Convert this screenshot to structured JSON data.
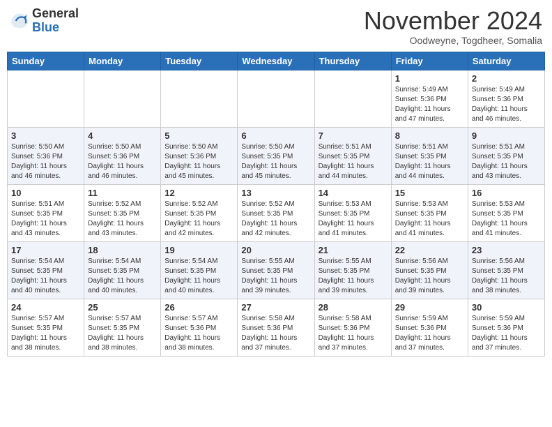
{
  "header": {
    "logo_general": "General",
    "logo_blue": "Blue",
    "month_title": "November 2024",
    "location": "Oodweyne, Togdheer, Somalia"
  },
  "calendar": {
    "days_of_week": [
      "Sunday",
      "Monday",
      "Tuesday",
      "Wednesday",
      "Thursday",
      "Friday",
      "Saturday"
    ],
    "weeks": [
      [
        {
          "day": "",
          "info": ""
        },
        {
          "day": "",
          "info": ""
        },
        {
          "day": "",
          "info": ""
        },
        {
          "day": "",
          "info": ""
        },
        {
          "day": "",
          "info": ""
        },
        {
          "day": "1",
          "info": "Sunrise: 5:49 AM\nSunset: 5:36 PM\nDaylight: 11 hours\nand 47 minutes."
        },
        {
          "day": "2",
          "info": "Sunrise: 5:49 AM\nSunset: 5:36 PM\nDaylight: 11 hours\nand 46 minutes."
        }
      ],
      [
        {
          "day": "3",
          "info": "Sunrise: 5:50 AM\nSunset: 5:36 PM\nDaylight: 11 hours\nand 46 minutes."
        },
        {
          "day": "4",
          "info": "Sunrise: 5:50 AM\nSunset: 5:36 PM\nDaylight: 11 hours\nand 46 minutes."
        },
        {
          "day": "5",
          "info": "Sunrise: 5:50 AM\nSunset: 5:36 PM\nDaylight: 11 hours\nand 45 minutes."
        },
        {
          "day": "6",
          "info": "Sunrise: 5:50 AM\nSunset: 5:35 PM\nDaylight: 11 hours\nand 45 minutes."
        },
        {
          "day": "7",
          "info": "Sunrise: 5:51 AM\nSunset: 5:35 PM\nDaylight: 11 hours\nand 44 minutes."
        },
        {
          "day": "8",
          "info": "Sunrise: 5:51 AM\nSunset: 5:35 PM\nDaylight: 11 hours\nand 44 minutes."
        },
        {
          "day": "9",
          "info": "Sunrise: 5:51 AM\nSunset: 5:35 PM\nDaylight: 11 hours\nand 43 minutes."
        }
      ],
      [
        {
          "day": "10",
          "info": "Sunrise: 5:51 AM\nSunset: 5:35 PM\nDaylight: 11 hours\nand 43 minutes."
        },
        {
          "day": "11",
          "info": "Sunrise: 5:52 AM\nSunset: 5:35 PM\nDaylight: 11 hours\nand 43 minutes."
        },
        {
          "day": "12",
          "info": "Sunrise: 5:52 AM\nSunset: 5:35 PM\nDaylight: 11 hours\nand 42 minutes."
        },
        {
          "day": "13",
          "info": "Sunrise: 5:52 AM\nSunset: 5:35 PM\nDaylight: 11 hours\nand 42 minutes."
        },
        {
          "day": "14",
          "info": "Sunrise: 5:53 AM\nSunset: 5:35 PM\nDaylight: 11 hours\nand 41 minutes."
        },
        {
          "day": "15",
          "info": "Sunrise: 5:53 AM\nSunset: 5:35 PM\nDaylight: 11 hours\nand 41 minutes."
        },
        {
          "day": "16",
          "info": "Sunrise: 5:53 AM\nSunset: 5:35 PM\nDaylight: 11 hours\nand 41 minutes."
        }
      ],
      [
        {
          "day": "17",
          "info": "Sunrise: 5:54 AM\nSunset: 5:35 PM\nDaylight: 11 hours\nand 40 minutes."
        },
        {
          "day": "18",
          "info": "Sunrise: 5:54 AM\nSunset: 5:35 PM\nDaylight: 11 hours\nand 40 minutes."
        },
        {
          "day": "19",
          "info": "Sunrise: 5:54 AM\nSunset: 5:35 PM\nDaylight: 11 hours\nand 40 minutes."
        },
        {
          "day": "20",
          "info": "Sunrise: 5:55 AM\nSunset: 5:35 PM\nDaylight: 11 hours\nand 39 minutes."
        },
        {
          "day": "21",
          "info": "Sunrise: 5:55 AM\nSunset: 5:35 PM\nDaylight: 11 hours\nand 39 minutes."
        },
        {
          "day": "22",
          "info": "Sunrise: 5:56 AM\nSunset: 5:35 PM\nDaylight: 11 hours\nand 39 minutes."
        },
        {
          "day": "23",
          "info": "Sunrise: 5:56 AM\nSunset: 5:35 PM\nDaylight: 11 hours\nand 38 minutes."
        }
      ],
      [
        {
          "day": "24",
          "info": "Sunrise: 5:57 AM\nSunset: 5:35 PM\nDaylight: 11 hours\nand 38 minutes."
        },
        {
          "day": "25",
          "info": "Sunrise: 5:57 AM\nSunset: 5:35 PM\nDaylight: 11 hours\nand 38 minutes."
        },
        {
          "day": "26",
          "info": "Sunrise: 5:57 AM\nSunset: 5:36 PM\nDaylight: 11 hours\nand 38 minutes."
        },
        {
          "day": "27",
          "info": "Sunrise: 5:58 AM\nSunset: 5:36 PM\nDaylight: 11 hours\nand 37 minutes."
        },
        {
          "day": "28",
          "info": "Sunrise: 5:58 AM\nSunset: 5:36 PM\nDaylight: 11 hours\nand 37 minutes."
        },
        {
          "day": "29",
          "info": "Sunrise: 5:59 AM\nSunset: 5:36 PM\nDaylight: 11 hours\nand 37 minutes."
        },
        {
          "day": "30",
          "info": "Sunrise: 5:59 AM\nSunset: 5:36 PM\nDaylight: 11 hours\nand 37 minutes."
        }
      ]
    ]
  }
}
